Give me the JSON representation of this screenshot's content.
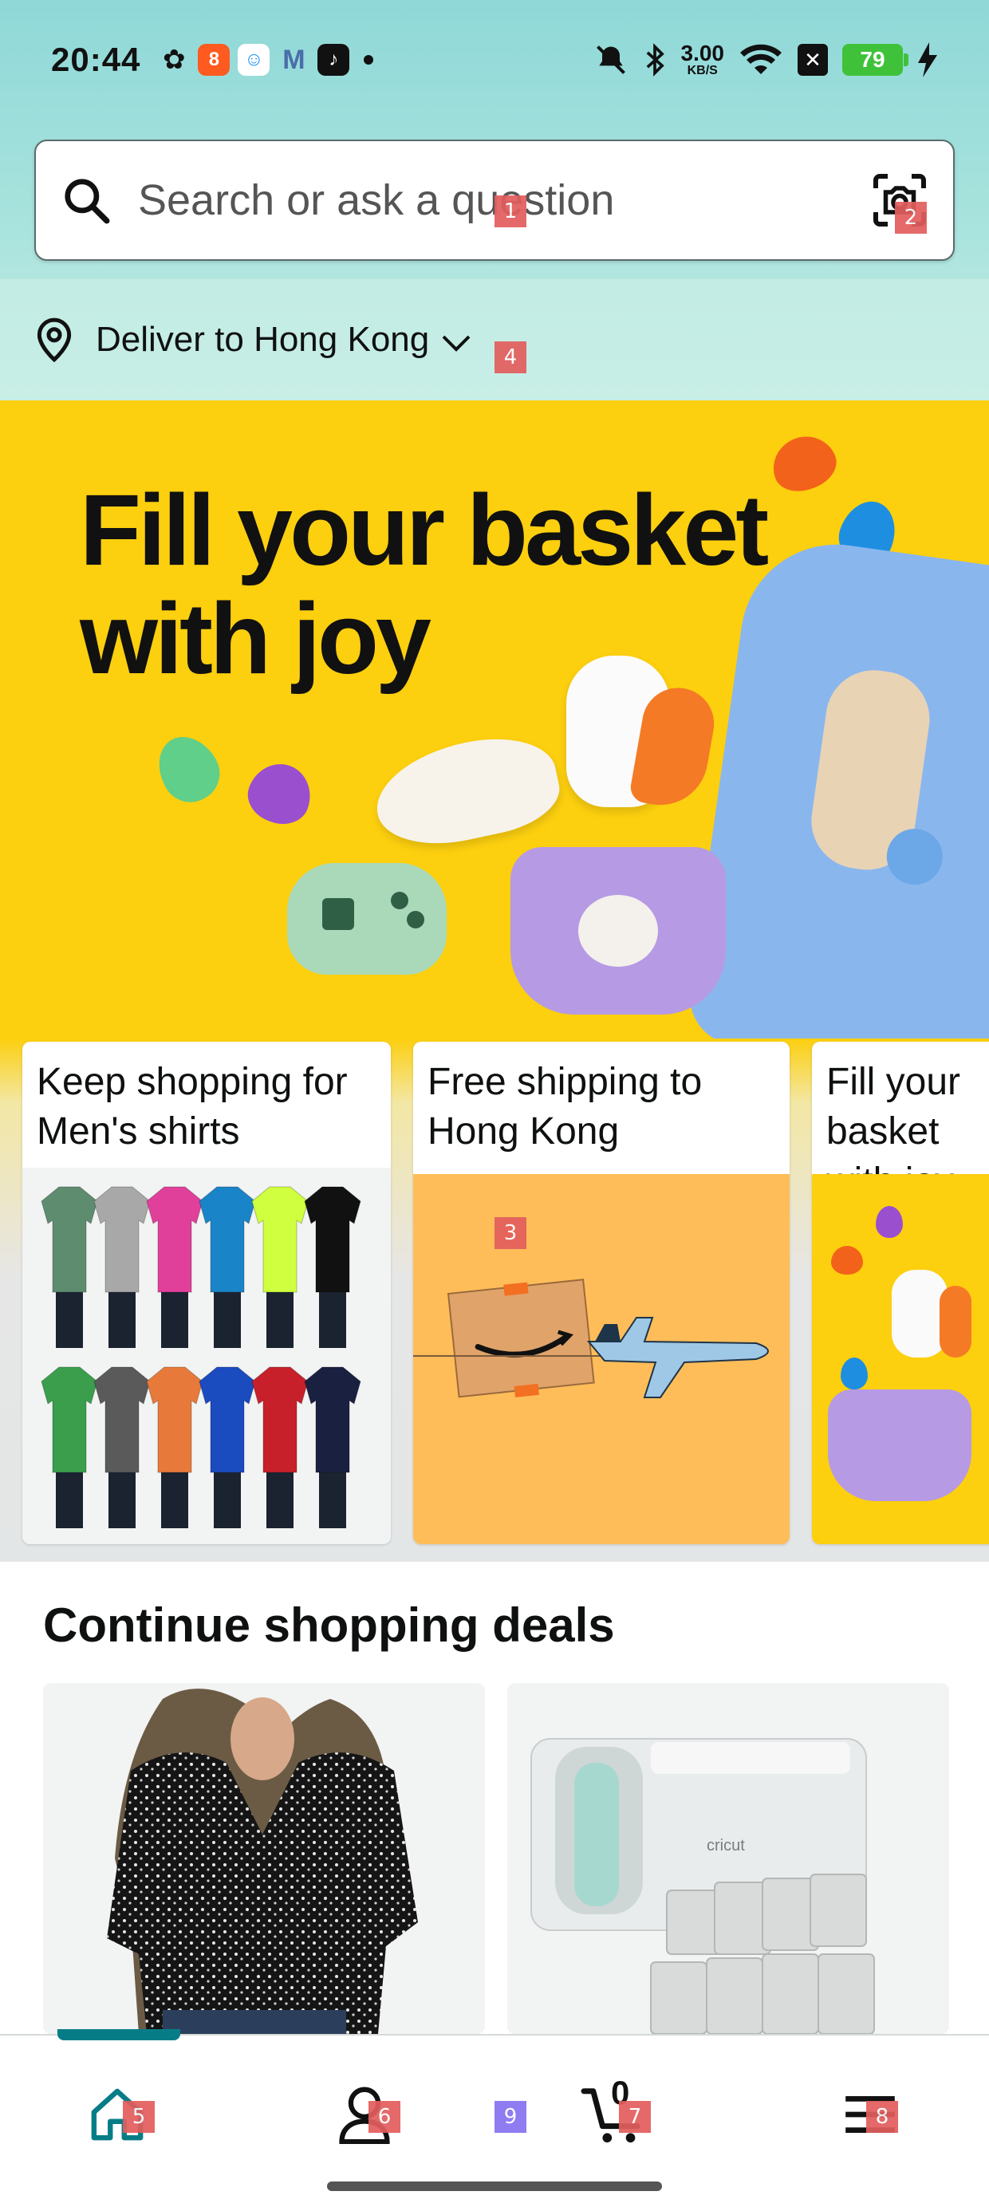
{
  "status_bar": {
    "time": "20:44",
    "apps": [
      {
        "name": "wechat-icon",
        "color": "#111111",
        "glyph": "❦"
      },
      {
        "name": "taobao-icon",
        "color": "#ff5a1f",
        "glyph": "8"
      },
      {
        "name": "qq-icon",
        "color": "#1e90ff",
        "glyph": "☺"
      },
      {
        "name": "gmail-icon",
        "color": "#ffffff",
        "glyph": "M"
      },
      {
        "name": "tiktok-icon",
        "color": "#111111",
        "glyph": "♪"
      }
    ],
    "speed_value": "3.00",
    "speed_unit": "KB/S",
    "battery": "79"
  },
  "search": {
    "placeholder": "Search or ask a question"
  },
  "deliver": {
    "label": "Deliver to Hong Kong"
  },
  "hero": {
    "title_line1": "Fill your basket",
    "title_line2": "with joy"
  },
  "cards": [
    {
      "title": "Keep shopping for Men's shirts"
    },
    {
      "title": "Free shipping to Hong Kong"
    },
    {
      "title": "Fill your basket with joy"
    }
  ],
  "deals": {
    "title": "Continue shopping deals",
    "product2_brand": "cricut"
  },
  "bottom_nav": {
    "cart_count": "0",
    "items": [
      "home-icon",
      "account-icon",
      "cart-icon",
      "menu-icon"
    ]
  },
  "markers": [
    "1",
    "2",
    "3",
    "4",
    "5",
    "6",
    "7",
    "8",
    "9"
  ],
  "colors": {
    "hero_bg": "#fccf0f",
    "accent": "#067d86",
    "shipping_bg": "#febd59"
  },
  "shirt_colors": {
    "row1": [
      "#5e8c6f",
      "#a8a8a8",
      "#e0409a",
      "#1a84c8",
      "#cfff3e",
      "#111111"
    ],
    "row2": [
      "#3a9e4c",
      "#5a5a5a",
      "#e77a3a",
      "#1a4bbf",
      "#c8202a",
      "#1a2040"
    ]
  }
}
